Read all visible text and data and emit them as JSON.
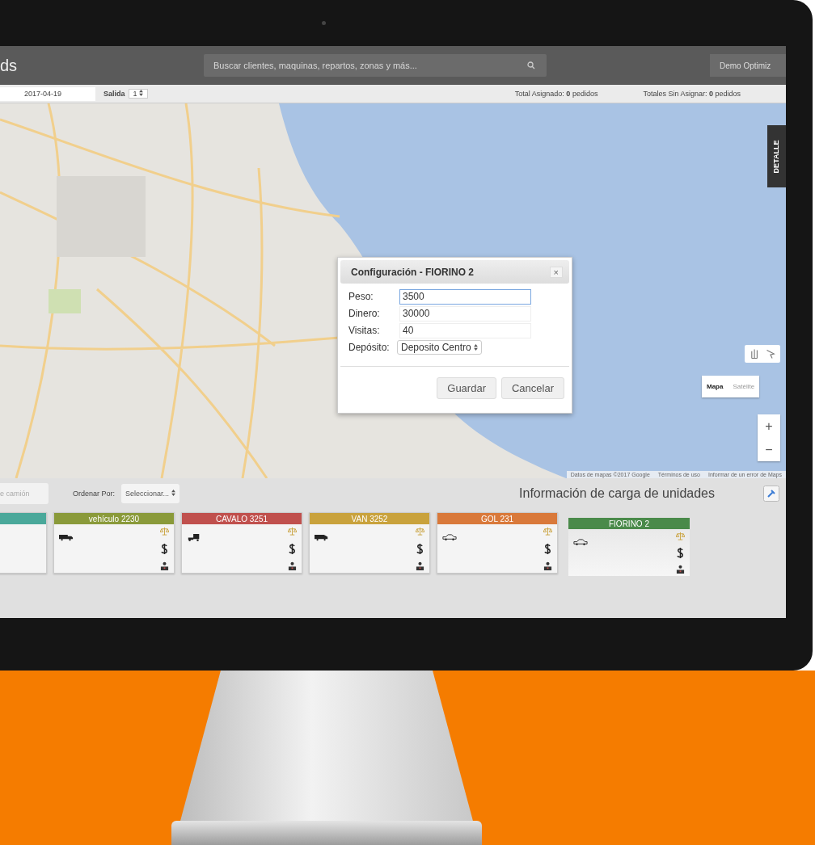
{
  "header": {
    "app_title": "ds",
    "search_placeholder": "Buscar clientes, maquinas, repartos, zonas y más...",
    "user_menu": "Demo Optimiz"
  },
  "toolbar": {
    "date": "2017-04-19",
    "salida_label": "Salida",
    "salida_value": "1",
    "total_asignado": "Total Asignado: **0** pedidos",
    "totales_sin_asignar": "Totales Sin Asignar: **0** pedidos"
  },
  "map": {
    "detail_tab": "DETALLE",
    "map_types": [
      {
        "label": "Mapa",
        "selected": true
      },
      {
        "label": "Satélite",
        "selected": false
      }
    ],
    "zoom_in": "+",
    "zoom_out": "−",
    "attribution": [
      "Datos de mapas ©2017 Google",
      "Términos de uso",
      "Informar de un error de Maps"
    ]
  },
  "dialog": {
    "title": "Configuración - FIORINO 2",
    "close": "×",
    "fields": [
      {
        "kind": "text",
        "label": "Peso:",
        "value": "3500",
        "focused": true
      },
      {
        "kind": "text",
        "label": "Dinero:",
        "value": "30000",
        "focused": false
      },
      {
        "kind": "text",
        "label": "Visitas:",
        "value": "40",
        "focused": false
      },
      {
        "kind": "select",
        "label": "Depósito:",
        "value": "Deposito Centro",
        "focused": false
      }
    ],
    "buttons": [
      "Guardar",
      "Cancelar"
    ]
  },
  "bottom": {
    "filter_placeholder": "e camión",
    "sort_label": "Ordenar Por:",
    "sort_value": "Seleccionar...",
    "title": "Información de carga de unidades",
    "vehicles": [
      {
        "color": "#4aa89a",
        "kind": "none",
        "selected": false
      },
      {
        "name": "vehículo 2230",
        "color": "#8a9a3a",
        "kind": "truck",
        "selected": false
      },
      {
        "name": "CAVALO 3251",
        "color": "#c0504d",
        "kind": "tractor",
        "selected": false
      },
      {
        "name": "VAN 3252",
        "color": "#c9a23c",
        "kind": "van",
        "selected": false
      },
      {
        "name": "GOL 231",
        "color": "#d9793a",
        "kind": "car",
        "selected": false
      },
      {
        "name": "FIORINO 2",
        "color": "#4a8a4a",
        "kind": "car",
        "selected": true
      }
    ]
  }
}
